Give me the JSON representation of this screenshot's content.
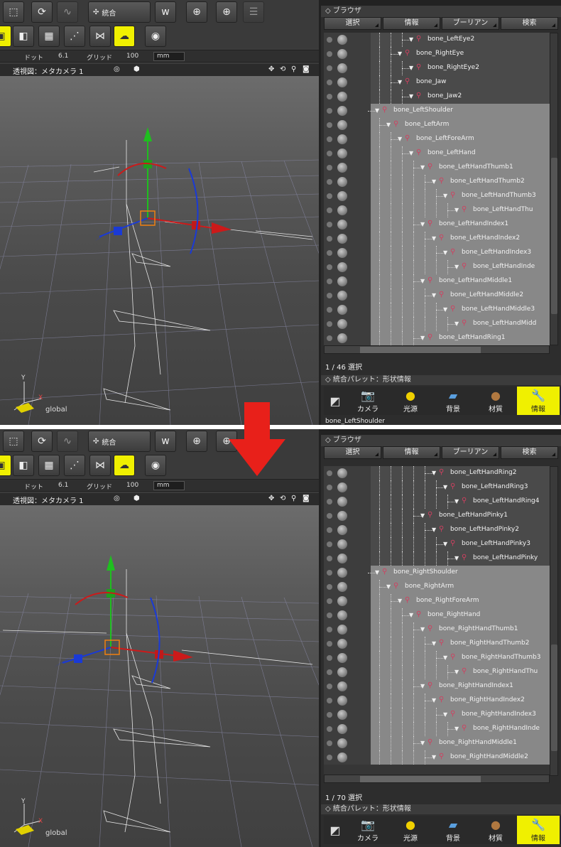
{
  "toolbar": {
    "merge_label": "統合"
  },
  "status": {
    "dot_label": "ドット",
    "dot_value": "6.1",
    "grid_label": "グリッド",
    "grid_value": "100",
    "unit": "mm"
  },
  "viewport": {
    "title": "透視図：メタカメラ 1",
    "axis_y": "Y",
    "axis_x": "X",
    "coord_mode": "global"
  },
  "browser": {
    "title": "ブラウザ",
    "tabs": [
      "選択",
      "情報",
      "ブーリアン",
      "検索"
    ]
  },
  "top": {
    "count_text": "1 / 46 選択",
    "rows": [
      {
        "label": "bone_LeftEye2",
        "depth": 4,
        "selected": false
      },
      {
        "label": "bone_RightEye",
        "depth": 3,
        "selected": false
      },
      {
        "label": "bone_RightEye2",
        "depth": 4,
        "selected": false
      },
      {
        "label": "bone_Jaw",
        "depth": 3,
        "selected": false
      },
      {
        "label": "bone_Jaw2",
        "depth": 4,
        "selected": false
      },
      {
        "label": "bone_LeftShoulder",
        "depth": 1,
        "selected": true
      },
      {
        "label": "bone_LeftArm",
        "depth": 2,
        "selected": true
      },
      {
        "label": "bone_LeftForeArm",
        "depth": 3,
        "selected": true
      },
      {
        "label": "bone_LeftHand",
        "depth": 4,
        "selected": true
      },
      {
        "label": "bone_LeftHandThumb1",
        "depth": 5,
        "selected": true
      },
      {
        "label": "bone_LeftHandThumb2",
        "depth": 6,
        "selected": true
      },
      {
        "label": "bone_LeftHandThumb3",
        "depth": 7,
        "selected": true
      },
      {
        "label": "bone_LeftHandThu",
        "depth": 8,
        "selected": true
      },
      {
        "label": "bone_LeftHandIndex1",
        "depth": 5,
        "selected": true
      },
      {
        "label": "bone_LeftHandIndex2",
        "depth": 6,
        "selected": true
      },
      {
        "label": "bone_LeftHandIndex3",
        "depth": 7,
        "selected": true
      },
      {
        "label": "bone_LeftHandInde",
        "depth": 8,
        "selected": true
      },
      {
        "label": "bone_LeftHandMiddle1",
        "depth": 5,
        "selected": true
      },
      {
        "label": "bone_LeftHandMiddle2",
        "depth": 6,
        "selected": true
      },
      {
        "label": "bone_LeftHandMiddle3",
        "depth": 7,
        "selected": true
      },
      {
        "label": "bone_LeftHandMidd",
        "depth": 8,
        "selected": true
      },
      {
        "label": "bone_LeftHandRing1",
        "depth": 5,
        "selected": true
      }
    ],
    "footer_text": "bone_LeftShoulder"
  },
  "bottom": {
    "count_text": "1 / 70 選択",
    "rows": [
      {
        "label": "bone_LeftHandRing2",
        "depth": 6,
        "selected": false
      },
      {
        "label": "bone_LeftHandRing3",
        "depth": 7,
        "selected": false
      },
      {
        "label": "bone_LeftHandRing4",
        "depth": 8,
        "selected": false
      },
      {
        "label": "bone_LeftHandPinky1",
        "depth": 5,
        "selected": false
      },
      {
        "label": "bone_LeftHandPinky2",
        "depth": 6,
        "selected": false
      },
      {
        "label": "bone_LeftHandPinky3",
        "depth": 7,
        "selected": false
      },
      {
        "label": "bone_LeftHandPinky",
        "depth": 8,
        "selected": false
      },
      {
        "label": "bone_RightShoulder",
        "depth": 1,
        "selected": true
      },
      {
        "label": "bone_RightArm",
        "depth": 2,
        "selected": true
      },
      {
        "label": "bone_RightForeArm",
        "depth": 3,
        "selected": true
      },
      {
        "label": "bone_RightHand",
        "depth": 4,
        "selected": true
      },
      {
        "label": "bone_RightHandThumb1",
        "depth": 5,
        "selected": true
      },
      {
        "label": "bone_RightHandThumb2",
        "depth": 6,
        "selected": true
      },
      {
        "label": "bone_RightHandThumb3",
        "depth": 7,
        "selected": true
      },
      {
        "label": "bone_RightHandThu",
        "depth": 8,
        "selected": true
      },
      {
        "label": "bone_RightHandIndex1",
        "depth": 5,
        "selected": true
      },
      {
        "label": "bone_RightHandIndex2",
        "depth": 6,
        "selected": true
      },
      {
        "label": "bone_RightHandIndex3",
        "depth": 7,
        "selected": true
      },
      {
        "label": "bone_RightHandInde",
        "depth": 8,
        "selected": true
      },
      {
        "label": "bone_RightHandMiddle1",
        "depth": 5,
        "selected": true
      },
      {
        "label": "bone_RightHandMiddle2",
        "depth": 6,
        "selected": true
      }
    ]
  },
  "palette": {
    "title": "統合パレット：形状情報",
    "buttons": [
      {
        "label": "カメラ",
        "icon": "camera-icon"
      },
      {
        "label": "光源",
        "icon": "light-icon"
      },
      {
        "label": "背景",
        "icon": "background-icon"
      },
      {
        "label": "材質",
        "icon": "material-icon"
      },
      {
        "label": "情報",
        "icon": "wrench-icon"
      }
    ]
  },
  "colors": {
    "highlight": "#f0f000",
    "arrow": "#e8201a",
    "selected_row": "#888888"
  }
}
